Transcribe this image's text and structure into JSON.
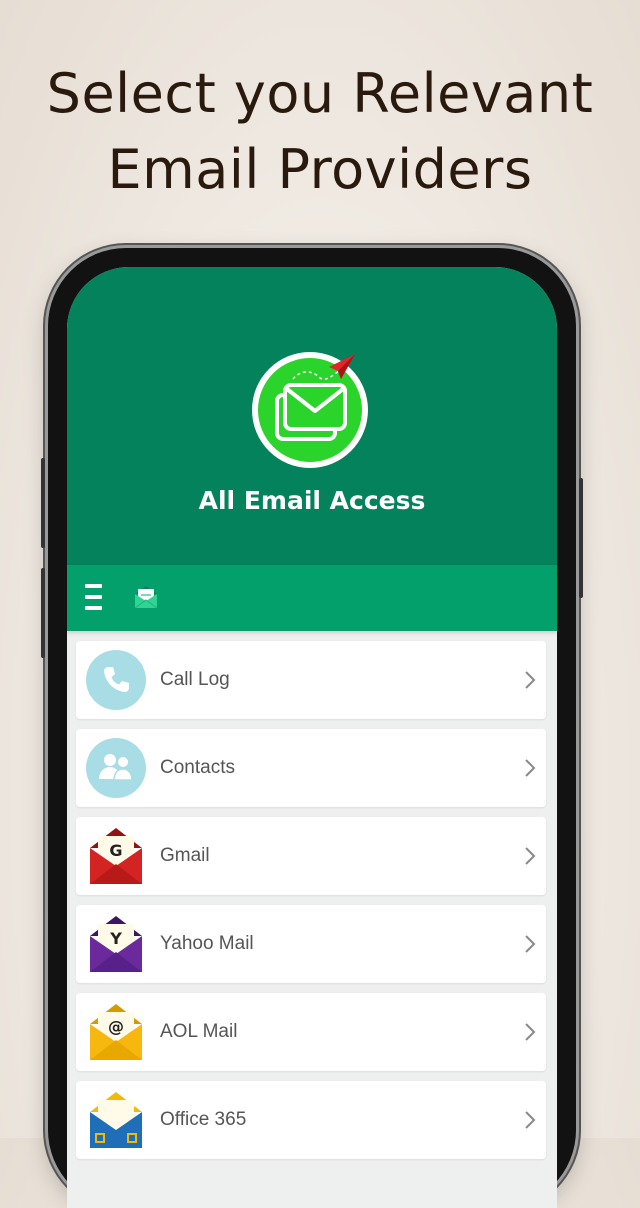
{
  "headline": {
    "line1": "Select you Relevant",
    "line2": "Email Providers"
  },
  "app": {
    "title": "All Email Access",
    "colors": {
      "header": "#04825b",
      "toolbar": "#03a06c",
      "logo_green": "#2bd42b"
    }
  },
  "toolbar": {
    "menu_icon": "hamburger-menu-icon",
    "envelope_icon": "mail-envelope-icon"
  },
  "list": {
    "items": [
      {
        "label": "Call Log",
        "icon": "phone-icon"
      },
      {
        "label": "Contacts",
        "icon": "contacts-icon"
      },
      {
        "label": "Gmail",
        "icon": "gmail-envelope-icon",
        "badge": "G"
      },
      {
        "label": "Yahoo Mail",
        "icon": "yahoo-envelope-icon",
        "badge": "Y"
      },
      {
        "label": "AOL Mail",
        "icon": "aol-envelope-icon",
        "badge": "@"
      },
      {
        "label": "Office 365",
        "icon": "office365-envelope-icon"
      }
    ]
  }
}
